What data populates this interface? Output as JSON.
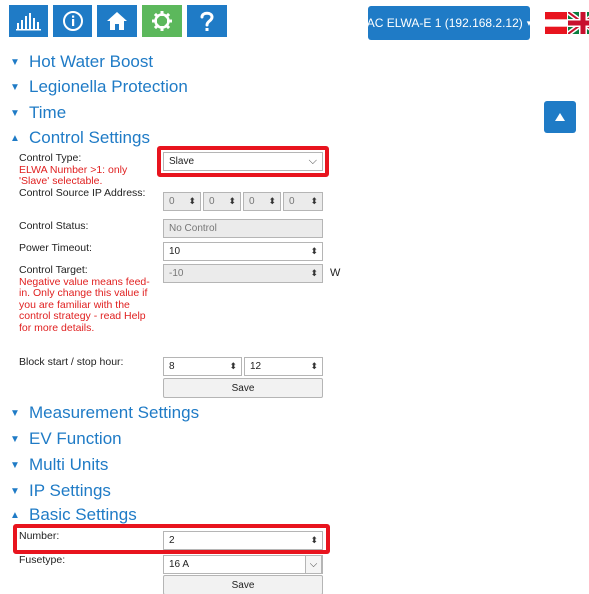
{
  "nav": {
    "items": [
      {
        "icon": "chart-bars-icon"
      },
      {
        "icon": "info-icon"
      },
      {
        "icon": "home-icon"
      },
      {
        "icon": "gear-icon"
      },
      {
        "icon": "help-icon"
      }
    ],
    "device_label": "AC ELWA-E 1 (192.168.2.12)",
    "caret": "▾"
  },
  "sections": {
    "hot_water_boost": "Hot Water Boost",
    "legionella": "Legionella Protection",
    "time": "Time",
    "control_settings": "Control Settings",
    "measurement_settings": "Measurement Settings",
    "ev_function": "EV Function",
    "multi_units": "Multi Units",
    "ip_settings": "IP Settings",
    "basic_settings": "Basic Settings"
  },
  "arrows": {
    "collapsed": "▼",
    "expanded": "▲"
  },
  "control": {
    "type_label": "Control Type:",
    "type_note": "ELWA Number >1: only 'Slave' selectable.",
    "type_value": "Slave",
    "source_ip_label": "Control Source IP Address:",
    "source_ip": [
      "0",
      "0",
      "0",
      "0"
    ],
    "status_label": "Control Status:",
    "status_value": "No Control",
    "timeout_label": "Power Timeout:",
    "timeout_value": "10",
    "target_label": "Control Target:",
    "target_note": "Negative value means feed-in. Only change this value if you are familiar with the control strategy - read Help for more details.",
    "target_value": "-10",
    "target_unit": "W",
    "block_label": "Block start / stop hour:",
    "block_start": "8",
    "block_stop": "12",
    "save_label": "Save"
  },
  "basic": {
    "number_label": "Number:",
    "number_value": "2",
    "fusetype_label": "Fusetype:",
    "fusetype_value": "16 A",
    "save_label": "Save"
  },
  "colors": {
    "brand_blue": "#1f7bc6",
    "active_green": "#5cb85c",
    "highlight_red": "#e8141e",
    "note_red": "#e02020"
  }
}
